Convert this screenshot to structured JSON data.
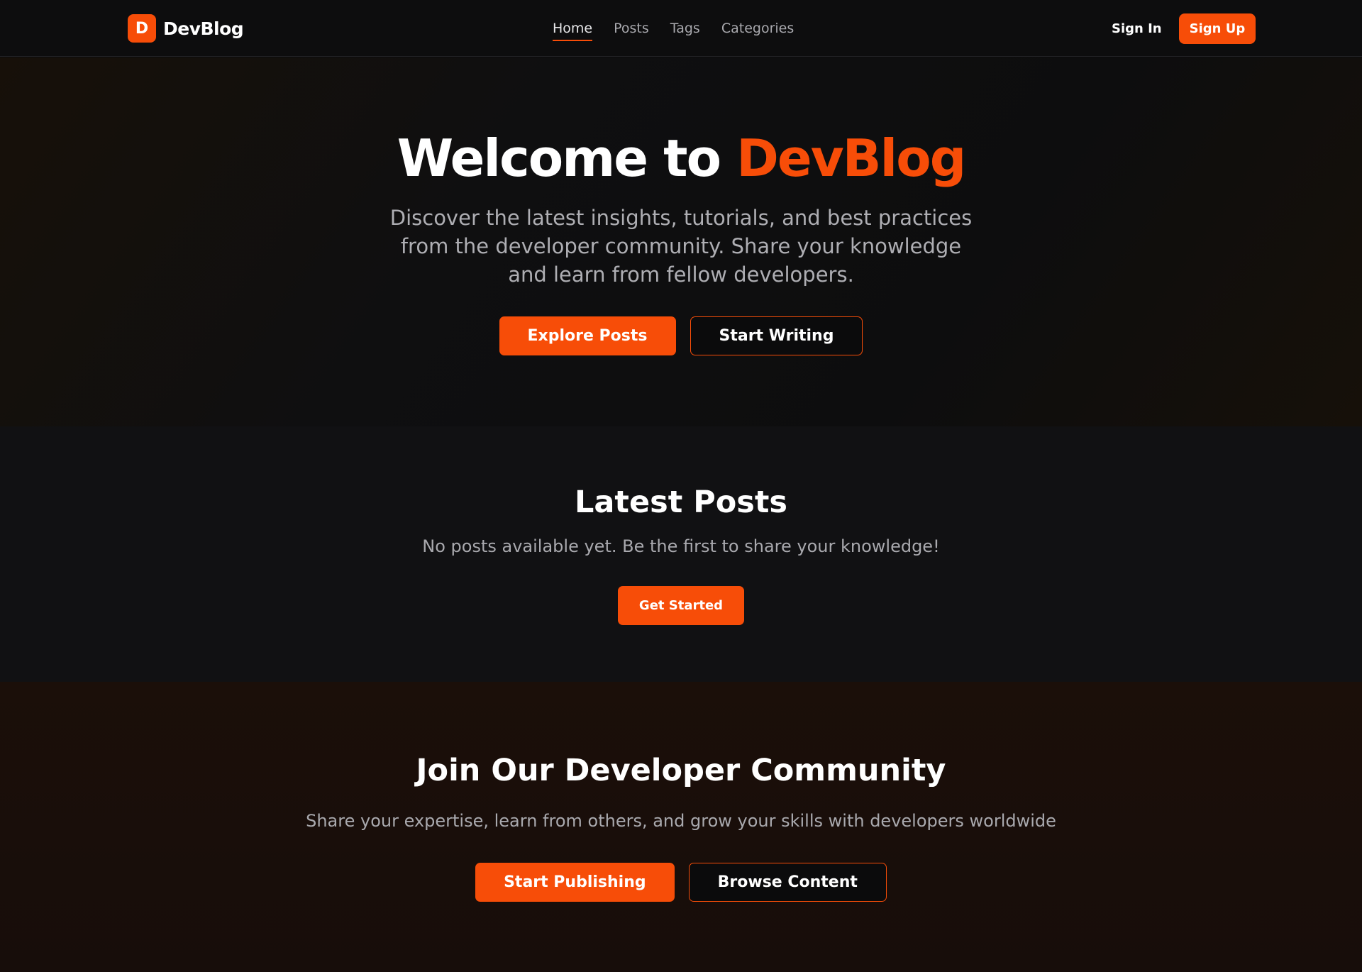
{
  "brand": {
    "logo_letter": "D",
    "name": "DevBlog",
    "accent_color": "#f74d08"
  },
  "nav": {
    "links": [
      {
        "label": "Home",
        "active": true
      },
      {
        "label": "Posts",
        "active": false
      },
      {
        "label": "Tags",
        "active": false
      },
      {
        "label": "Categories",
        "active": false
      }
    ],
    "sign_in": "Sign In",
    "sign_up": "Sign Up"
  },
  "hero": {
    "title_prefix": "Welcome to ",
    "title_accent": "DevBlog",
    "subtitle": "Discover the latest insights, tutorials, and best practices from the developer community. Share your knowledge and learn from fellow developers.",
    "primary_button": "Explore Posts",
    "secondary_button": "Start Writing"
  },
  "latest_posts": {
    "title": "Latest Posts",
    "empty_message": "No posts available yet. Be the first to share your knowledge!",
    "button": "Get Started"
  },
  "community": {
    "title": "Join Our Developer Community",
    "subtitle": "Share your expertise, learn from others, and grow your skills with developers worldwide",
    "primary_button": "Start Publishing",
    "secondary_button": "Browse Content"
  }
}
